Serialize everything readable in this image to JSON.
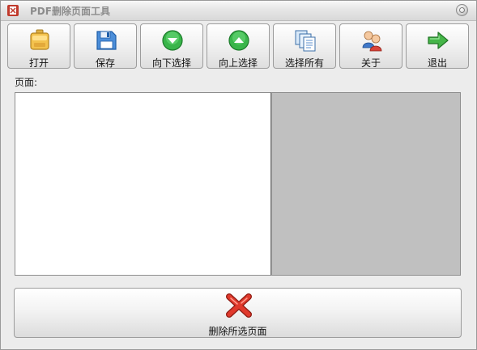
{
  "window": {
    "title": "PDF删除页面工具"
  },
  "toolbar": {
    "buttons": [
      {
        "id": "open",
        "label": "打开",
        "icon": "open-folder-icon"
      },
      {
        "id": "save",
        "label": "保存",
        "icon": "floppy-disk-icon"
      },
      {
        "id": "select-down",
        "label": "向下选择",
        "icon": "arrow-down-circle-icon"
      },
      {
        "id": "select-up",
        "label": "向上选择",
        "icon": "arrow-up-circle-icon"
      },
      {
        "id": "select-all",
        "label": "选择所有",
        "icon": "documents-stack-icon"
      },
      {
        "id": "about",
        "label": "关于",
        "icon": "users-icon"
      },
      {
        "id": "exit",
        "label": "退出",
        "icon": "arrow-right-icon"
      }
    ]
  },
  "pages": {
    "label": "页面:"
  },
  "actions": {
    "delete_label": "删除所选页面",
    "delete_icon": "red-x-icon"
  },
  "colors": {
    "preview_background": "#c0c0c0",
    "list_background": "#ffffff",
    "title_text": "#8c8c8c"
  }
}
